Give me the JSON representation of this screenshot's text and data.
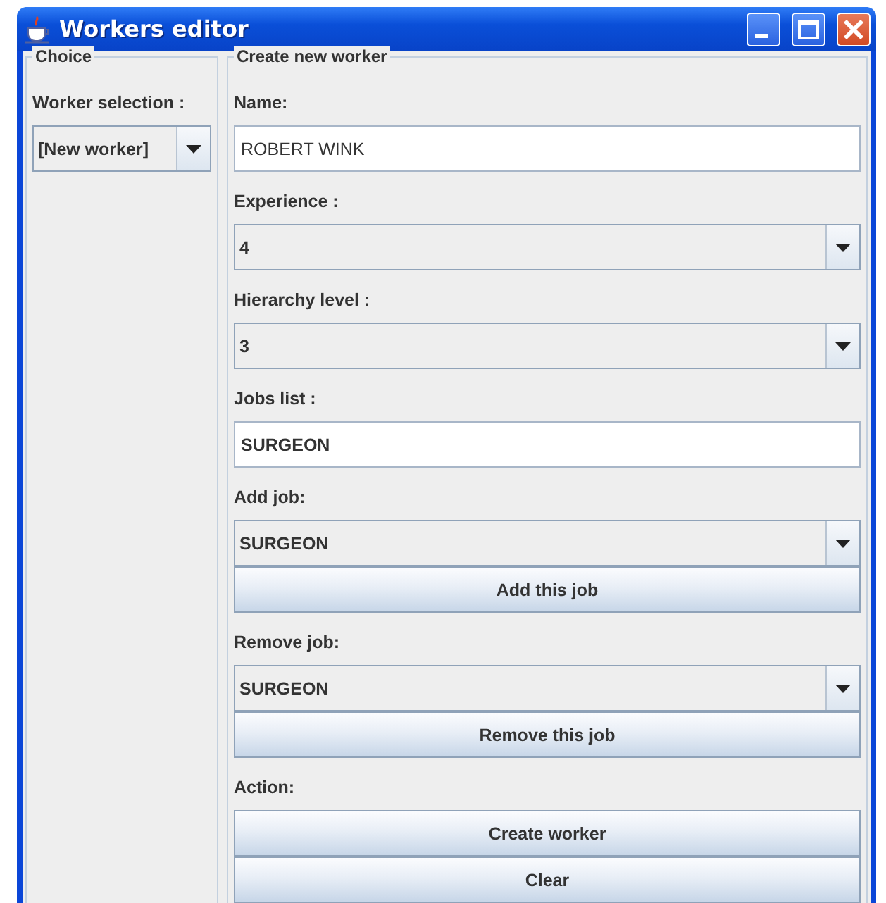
{
  "window": {
    "title": "Workers editor"
  },
  "choice": {
    "title": "Choice",
    "label": "Worker selection :",
    "value": "[New worker]"
  },
  "form": {
    "title": "Create new worker",
    "items": [
      {
        "kind": "label",
        "text": "Name:"
      },
      {
        "kind": "textfield",
        "value": "ROBERT WINK",
        "bold": false
      },
      {
        "kind": "label",
        "text": "Experience :"
      },
      {
        "kind": "combo",
        "value": "4"
      },
      {
        "kind": "label",
        "text": "Hierarchy level :"
      },
      {
        "kind": "combo",
        "value": "3"
      },
      {
        "kind": "label",
        "text": "Jobs list :"
      },
      {
        "kind": "textfield",
        "value": "SURGEON",
        "bold": true
      },
      {
        "kind": "label",
        "text": "Add job:"
      },
      {
        "kind": "combo",
        "value": "SURGEON"
      },
      {
        "kind": "button",
        "text": "Add this job"
      },
      {
        "kind": "label",
        "text": "Remove job:"
      },
      {
        "kind": "combo",
        "value": "SURGEON"
      },
      {
        "kind": "button",
        "text": "Remove this job"
      },
      {
        "kind": "label",
        "text": "Action:"
      },
      {
        "kind": "button",
        "text": "Create worker"
      },
      {
        "kind": "button",
        "text": "Clear"
      }
    ]
  }
}
